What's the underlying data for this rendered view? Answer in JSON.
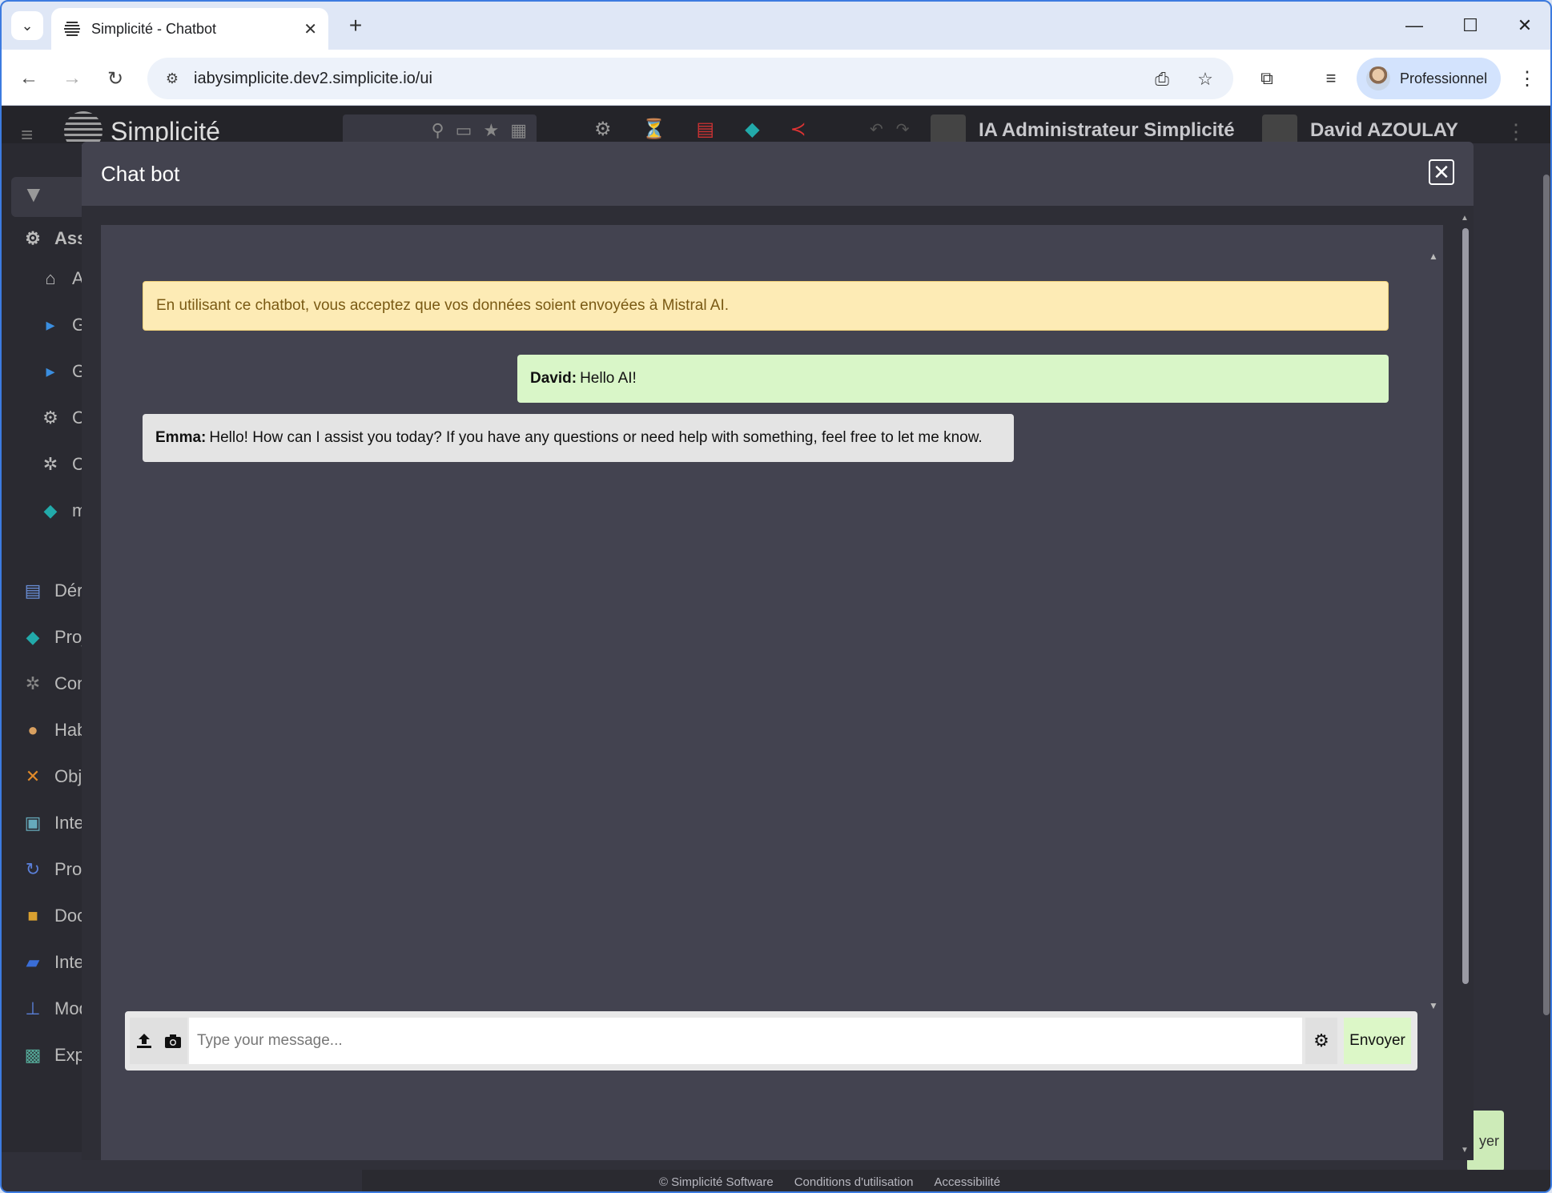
{
  "browser": {
    "tab_title": "Simplicité - Chatbot",
    "url": "iabysimplicite.dev2.simplicite.io/ui",
    "profile_name": "Professionnel"
  },
  "app": {
    "logo_text": "Simplicité",
    "header_user_1": "IA Administrateur Simplicité",
    "header_user_2": "David AZOULAY",
    "sidebar": [
      {
        "label": "Ass",
        "icon": "robot-icon",
        "bold": true
      },
      {
        "label": "A",
        "icon": "home-icon"
      },
      {
        "label": "G",
        "icon": "caret-right-icon"
      },
      {
        "label": "G",
        "icon": "caret-right-icon"
      },
      {
        "label": "C",
        "icon": "robot-icon"
      },
      {
        "label": "C",
        "icon": "gear-icon"
      },
      {
        "label": "m",
        "icon": "cubes-icon"
      },
      {
        "label": "Dér",
        "icon": "list-icon"
      },
      {
        "label": "Proj",
        "icon": "cubes-icon"
      },
      {
        "label": "Con",
        "icon": "gear-icon"
      },
      {
        "label": "Hab",
        "icon": "user-icon"
      },
      {
        "label": "Obj",
        "icon": "tools-icon"
      },
      {
        "label": "Inte",
        "icon": "image-icon"
      },
      {
        "label": "Pro",
        "icon": "process-icon"
      },
      {
        "label": "Doc",
        "icon": "folder-icon"
      },
      {
        "label": "Inte",
        "icon": "chat-icon"
      },
      {
        "label": "Mod",
        "icon": "hierarchy-icon"
      },
      {
        "label": "Exp",
        "icon": "monitor-icon"
      }
    ],
    "bg_button_partial": "yer",
    "footer": {
      "copyright": "© Simplicité Software",
      "terms": "Conditions d'utilisation",
      "accessibility": "Accessibilité"
    }
  },
  "modal": {
    "title": "Chat bot",
    "notice": "En utilisant ce chatbot, vous acceptez que vos données soient envoyées à Mistral AI.",
    "messages": [
      {
        "author": "David:",
        "text": "Hello AI!",
        "role": "user"
      },
      {
        "author": "Emma:",
        "text": "Hello! How can I assist you today? If you have any questions or need help with something, feel free to let me know.",
        "role": "bot"
      }
    ],
    "input_placeholder": "Type your message...",
    "send_label": "Envoyer"
  },
  "colors": {
    "notice_bg": "#fdebb5",
    "user_msg_bg": "#d9f6c8",
    "bot_msg_bg": "#e4e4e4",
    "send_bg": "#dcf7c7",
    "panel_bg": "#434350"
  }
}
